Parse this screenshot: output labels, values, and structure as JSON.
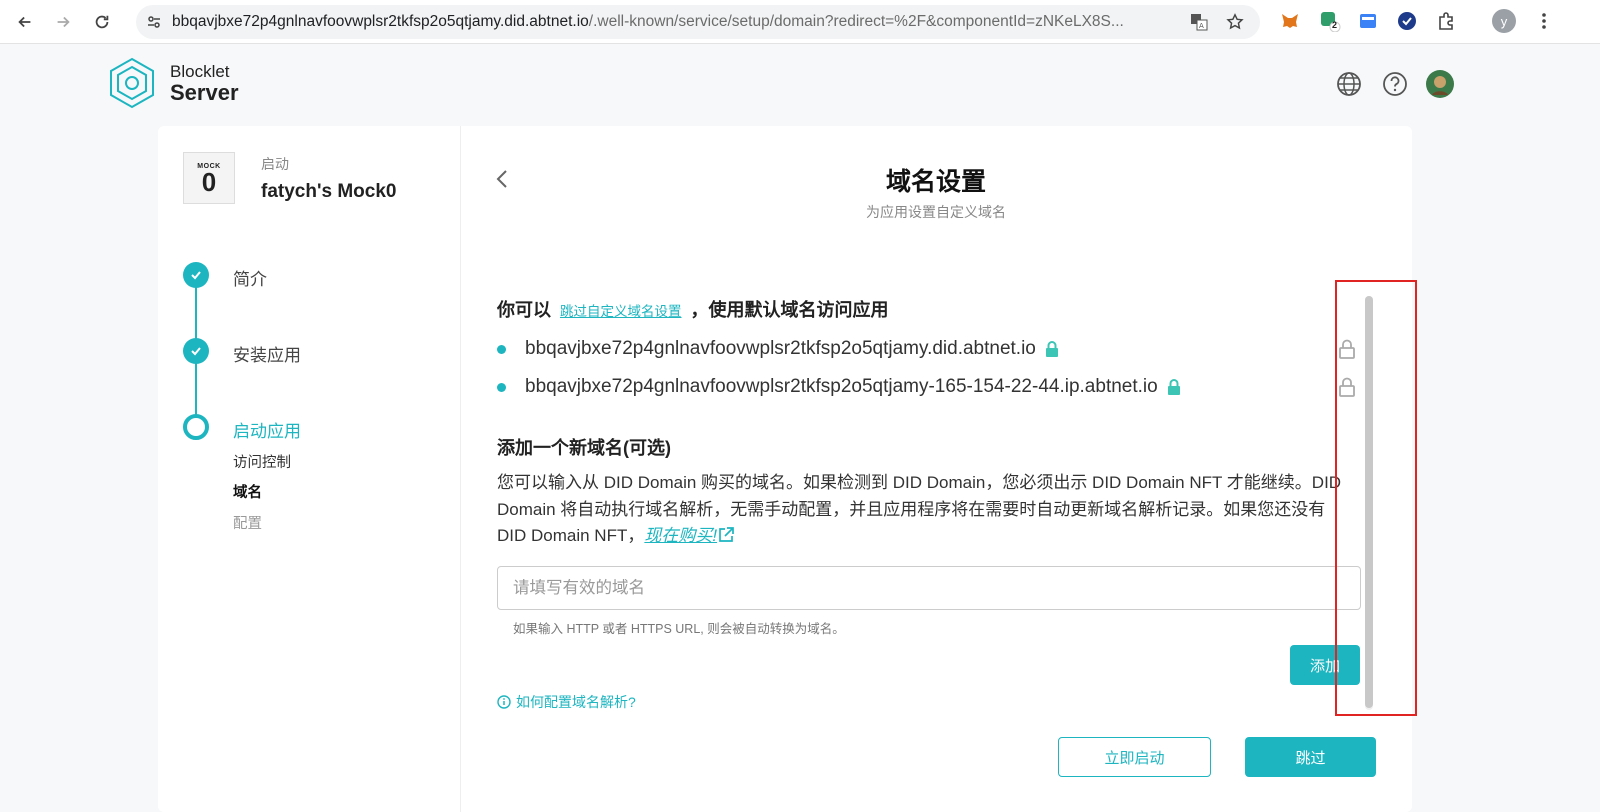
{
  "browser": {
    "url_main": "bbqavjbxe72p4gnlnavfoovwplsr2tkfsp2o5qtjamy.did.abtnet.io",
    "url_rest": "/.well-known/service/setup/domain?redirect=%2F&componentId=zNKeLX8S...",
    "profile_initial": "y",
    "ext_badge": "2"
  },
  "header": {
    "brand_top": "Blocklet",
    "brand_bottom": "Server"
  },
  "app": {
    "thumb_text": "MOCK",
    "thumb_digit": "0",
    "status": "启动",
    "name": "fatych's Mock0"
  },
  "steps": [
    {
      "label": "简介",
      "state": "done"
    },
    {
      "label": "安装应用",
      "state": "done"
    },
    {
      "label": "启动应用",
      "state": "active"
    }
  ],
  "sub_steps": [
    {
      "label": "访问控制",
      "state": "normal"
    },
    {
      "label": "域名",
      "state": "current"
    },
    {
      "label": "配置",
      "state": "pending"
    }
  ],
  "page": {
    "title": "域名设置",
    "subtitle": "为应用设置自定义域名"
  },
  "default_domains": {
    "prefix": "你可以",
    "skip_link": "跳过自定义域名设置",
    "suffix": "，使用默认域名访问应用",
    "items": [
      "bbqavjbxe72p4gnlnavfoovwplsr2tkfsp2o5qtjamy.did.abtnet.io",
      "bbqavjbxe72p4gnlnavfoovwplsr2tkfsp2o5qtjamy-165-154-22-44.ip.abtnet.io"
    ]
  },
  "new_domain": {
    "title": "添加一个新域名(可选)",
    "description": "您可以输入从 DID Domain 购买的域名。如果检测到 DID Domain，您必须出示 DID Domain NFT 才能继续。DID Domain 将自动执行域名解析，无需手动配置，并且应用程序将在需要时自动更新域名解析记录。如果您还没有 DID Domain NFT，",
    "buy_link": "现在购买!",
    "input_value": "",
    "input_placeholder": "请填写有效的域名",
    "hint": "如果输入 HTTP 或者 HTTPS URL, 则会被自动转换为域名。",
    "add_button": "添加",
    "help_link": "如何配置域名解析?"
  },
  "footer": {
    "launch_button": "立即启动",
    "skip_button": "跳过"
  },
  "colors": {
    "accent": "#1cb5c0",
    "highlight": "#e02424"
  }
}
